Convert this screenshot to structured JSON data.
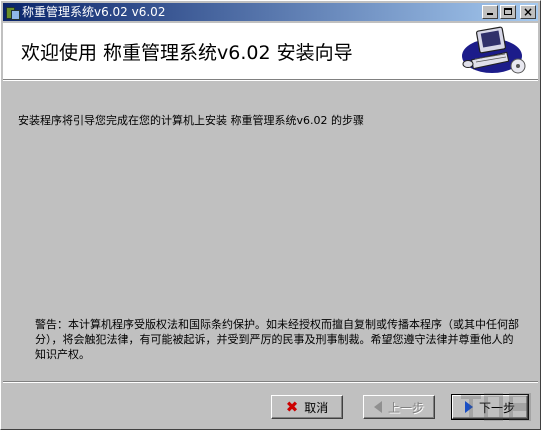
{
  "window": {
    "title": "称重管理系统v6.02 v6.02"
  },
  "header": {
    "title": "欢迎使用 称重管理系统v6.02 安装向导",
    "logo_icon": "computer-setup-icon"
  },
  "body": {
    "intro_text": "安装程序将引导您完成在您的计算机上安装 称重管理系统v6.02 的步骤",
    "warning_text": "警告：本计算机程序受版权法和国际条约保护。如未经授权而擅自复制或传播本程序（或其中任何部分），将会触犯法律，有可能被起诉，并受到严厉的民事及刑事制裁。希望您遵守法律并尊重他人的知识产权。"
  },
  "buttons": {
    "cancel_label": "取消",
    "back_label": "上一步",
    "next_label": "下一步"
  },
  "colors": {
    "title_bar_start": "#0a246a",
    "title_bar_end": "#a6caf0",
    "dialog_bg": "#c0c0c0",
    "cancel_icon": "#cc0000",
    "next_icon": "#1a4fc4"
  }
}
